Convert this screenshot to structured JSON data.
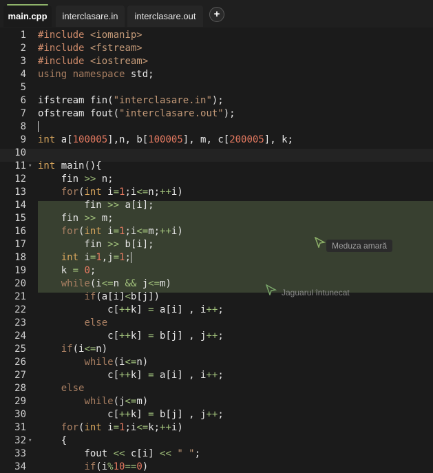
{
  "tabs": [
    {
      "label": "main.cpp",
      "active": true
    },
    {
      "label": "interclasare.in",
      "active": false
    },
    {
      "label": "interclasare.out",
      "active": false
    }
  ],
  "add_tab_label": "+",
  "lines": [
    {
      "num": "1",
      "segs": [
        {
          "c": "pp",
          "t": "#include"
        },
        {
          "c": "",
          "t": " "
        },
        {
          "c": "str",
          "t": "<iomanip>"
        }
      ]
    },
    {
      "num": "2",
      "segs": [
        {
          "c": "pp",
          "t": "#include"
        },
        {
          "c": "",
          "t": " "
        },
        {
          "c": "str",
          "t": "<fstream>"
        }
      ]
    },
    {
      "num": "3",
      "segs": [
        {
          "c": "pp",
          "t": "#include"
        },
        {
          "c": "",
          "t": " "
        },
        {
          "c": "str",
          "t": "<iostream>"
        }
      ]
    },
    {
      "num": "4",
      "segs": [
        {
          "c": "kw",
          "t": "using namespace"
        },
        {
          "c": "",
          "t": " std;"
        }
      ]
    },
    {
      "num": "5",
      "segs": []
    },
    {
      "num": "6",
      "segs": [
        {
          "c": "",
          "t": "ifstream fin("
        },
        {
          "c": "str",
          "t": "\"interclasare.in\""
        },
        {
          "c": "",
          "t": ");"
        }
      ]
    },
    {
      "num": "7",
      "segs": [
        {
          "c": "",
          "t": "ofstream fout("
        },
        {
          "c": "str",
          "t": "\"interclasare.out\""
        },
        {
          "c": "",
          "t": ");"
        }
      ]
    },
    {
      "num": "8",
      "segs": []
    },
    {
      "num": "9",
      "segs": [
        {
          "c": "typ",
          "t": "int"
        },
        {
          "c": "",
          "t": " a["
        },
        {
          "c": "num",
          "t": "100005"
        },
        {
          "c": "",
          "t": "],n, b["
        },
        {
          "c": "num",
          "t": "100005"
        },
        {
          "c": "",
          "t": "], m, c["
        },
        {
          "c": "num",
          "t": "200005"
        },
        {
          "c": "",
          "t": "], k;"
        }
      ]
    },
    {
      "num": "10",
      "segs": []
    },
    {
      "num": "11",
      "fold": true,
      "segs": [
        {
          "c": "typ",
          "t": "int"
        },
        {
          "c": "",
          "t": " main(){"
        }
      ]
    },
    {
      "num": "12",
      "segs": [
        {
          "c": "",
          "t": "    fin "
        },
        {
          "c": "op",
          "t": ">>"
        },
        {
          "c": "",
          "t": " n;"
        }
      ]
    },
    {
      "num": "13",
      "segs": [
        {
          "c": "",
          "t": "    "
        },
        {
          "c": "kw",
          "t": "for"
        },
        {
          "c": "",
          "t": "("
        },
        {
          "c": "typ",
          "t": "int"
        },
        {
          "c": "",
          "t": " i"
        },
        {
          "c": "op",
          "t": "="
        },
        {
          "c": "num",
          "t": "1"
        },
        {
          "c": "",
          "t": ";i"
        },
        {
          "c": "op",
          "t": "<="
        },
        {
          "c": "",
          "t": "n;"
        },
        {
          "c": "op",
          "t": "++"
        },
        {
          "c": "",
          "t": "i)"
        }
      ]
    },
    {
      "num": "14",
      "segs": [
        {
          "c": "",
          "t": "        fin "
        },
        {
          "c": "op",
          "t": ">>"
        },
        {
          "c": "",
          "t": " a[i];"
        }
      ]
    },
    {
      "num": "15",
      "segs": [
        {
          "c": "",
          "t": "    fin "
        },
        {
          "c": "op",
          "t": ">>"
        },
        {
          "c": "",
          "t": " m;"
        }
      ]
    },
    {
      "num": "16",
      "segs": [
        {
          "c": "",
          "t": "    "
        },
        {
          "c": "kw",
          "t": "for"
        },
        {
          "c": "",
          "t": "("
        },
        {
          "c": "typ",
          "t": "int"
        },
        {
          "c": "",
          "t": " i"
        },
        {
          "c": "op",
          "t": "="
        },
        {
          "c": "num",
          "t": "1"
        },
        {
          "c": "",
          "t": ";i"
        },
        {
          "c": "op",
          "t": "<="
        },
        {
          "c": "",
          "t": "m;"
        },
        {
          "c": "op",
          "t": "++"
        },
        {
          "c": "",
          "t": "i)"
        }
      ]
    },
    {
      "num": "17",
      "segs": [
        {
          "c": "",
          "t": "        fin "
        },
        {
          "c": "op",
          "t": ">>"
        },
        {
          "c": "",
          "t": " b[i];"
        }
      ]
    },
    {
      "num": "18",
      "segs": [
        {
          "c": "",
          "t": "    "
        },
        {
          "c": "typ",
          "t": "int"
        },
        {
          "c": "",
          "t": " i"
        },
        {
          "c": "op",
          "t": "="
        },
        {
          "c": "num",
          "t": "1"
        },
        {
          "c": "",
          "t": ",j"
        },
        {
          "c": "op",
          "t": "="
        },
        {
          "c": "num",
          "t": "1"
        },
        {
          "c": "",
          "t": ";"
        }
      ]
    },
    {
      "num": "19",
      "segs": [
        {
          "c": "",
          "t": "    k "
        },
        {
          "c": "op",
          "t": "="
        },
        {
          "c": "",
          "t": " "
        },
        {
          "c": "num",
          "t": "0"
        },
        {
          "c": "",
          "t": ";"
        }
      ]
    },
    {
      "num": "20",
      "segs": [
        {
          "c": "",
          "t": "    "
        },
        {
          "c": "kw",
          "t": "while"
        },
        {
          "c": "",
          "t": "(i"
        },
        {
          "c": "op",
          "t": "<="
        },
        {
          "c": "",
          "t": "n "
        },
        {
          "c": "op",
          "t": "&&"
        },
        {
          "c": "",
          "t": " j"
        },
        {
          "c": "op",
          "t": "<="
        },
        {
          "c": "",
          "t": "m)"
        }
      ]
    },
    {
      "num": "21",
      "segs": [
        {
          "c": "",
          "t": "        "
        },
        {
          "c": "kw",
          "t": "if"
        },
        {
          "c": "",
          "t": "(a[i]"
        },
        {
          "c": "op",
          "t": "<"
        },
        {
          "c": "",
          "t": "b[j])"
        }
      ]
    },
    {
      "num": "22",
      "segs": [
        {
          "c": "",
          "t": "            c["
        },
        {
          "c": "op",
          "t": "++"
        },
        {
          "c": "",
          "t": "k] "
        },
        {
          "c": "op",
          "t": "="
        },
        {
          "c": "",
          "t": " a[i] , i"
        },
        {
          "c": "op",
          "t": "++"
        },
        {
          "c": "",
          "t": ";"
        }
      ]
    },
    {
      "num": "23",
      "segs": [
        {
          "c": "",
          "t": "        "
        },
        {
          "c": "kw",
          "t": "else"
        }
      ]
    },
    {
      "num": "24",
      "segs": [
        {
          "c": "",
          "t": "            c["
        },
        {
          "c": "op",
          "t": "++"
        },
        {
          "c": "",
          "t": "k] "
        },
        {
          "c": "op",
          "t": "="
        },
        {
          "c": "",
          "t": " b[j] , j"
        },
        {
          "c": "op",
          "t": "++"
        },
        {
          "c": "",
          "t": ";"
        }
      ]
    },
    {
      "num": "25",
      "segs": [
        {
          "c": "",
          "t": "    "
        },
        {
          "c": "kw",
          "t": "if"
        },
        {
          "c": "",
          "t": "(i"
        },
        {
          "c": "op",
          "t": "<="
        },
        {
          "c": "",
          "t": "n)"
        }
      ]
    },
    {
      "num": "26",
      "segs": [
        {
          "c": "",
          "t": "        "
        },
        {
          "c": "kw",
          "t": "while"
        },
        {
          "c": "",
          "t": "(i"
        },
        {
          "c": "op",
          "t": "<="
        },
        {
          "c": "",
          "t": "n)"
        }
      ]
    },
    {
      "num": "27",
      "segs": [
        {
          "c": "",
          "t": "            c["
        },
        {
          "c": "op",
          "t": "++"
        },
        {
          "c": "",
          "t": "k] "
        },
        {
          "c": "op",
          "t": "="
        },
        {
          "c": "",
          "t": " a[i] , i"
        },
        {
          "c": "op",
          "t": "++"
        },
        {
          "c": "",
          "t": ";"
        }
      ]
    },
    {
      "num": "28",
      "segs": [
        {
          "c": "",
          "t": "    "
        },
        {
          "c": "kw",
          "t": "else"
        }
      ]
    },
    {
      "num": "29",
      "segs": [
        {
          "c": "",
          "t": "        "
        },
        {
          "c": "kw",
          "t": "while"
        },
        {
          "c": "",
          "t": "(j"
        },
        {
          "c": "op",
          "t": "<="
        },
        {
          "c": "",
          "t": "m)"
        }
      ]
    },
    {
      "num": "30",
      "segs": [
        {
          "c": "",
          "t": "            c["
        },
        {
          "c": "op",
          "t": "++"
        },
        {
          "c": "",
          "t": "k] "
        },
        {
          "c": "op",
          "t": "="
        },
        {
          "c": "",
          "t": " b[j] , j"
        },
        {
          "c": "op",
          "t": "++"
        },
        {
          "c": "",
          "t": ";"
        }
      ]
    },
    {
      "num": "31",
      "segs": [
        {
          "c": "",
          "t": "    "
        },
        {
          "c": "kw",
          "t": "for"
        },
        {
          "c": "",
          "t": "("
        },
        {
          "c": "typ",
          "t": "int"
        },
        {
          "c": "",
          "t": " i"
        },
        {
          "c": "op",
          "t": "="
        },
        {
          "c": "num",
          "t": "1"
        },
        {
          "c": "",
          "t": ";i"
        },
        {
          "c": "op",
          "t": "<="
        },
        {
          "c": "",
          "t": "k;"
        },
        {
          "c": "op",
          "t": "++"
        },
        {
          "c": "",
          "t": "i)"
        }
      ]
    },
    {
      "num": "32",
      "fold": true,
      "segs": [
        {
          "c": "",
          "t": "    {"
        }
      ]
    },
    {
      "num": "33",
      "segs": [
        {
          "c": "",
          "t": "        fout "
        },
        {
          "c": "op",
          "t": "<<"
        },
        {
          "c": "",
          "t": " c[i] "
        },
        {
          "c": "op",
          "t": "<<"
        },
        {
          "c": "",
          "t": " "
        },
        {
          "c": "str",
          "t": "\" \""
        },
        {
          "c": "",
          "t": ";"
        }
      ]
    },
    {
      "num": "34",
      "segs": [
        {
          "c": "",
          "t": "        "
        },
        {
          "c": "kw",
          "t": "if"
        },
        {
          "c": "",
          "t": "(i"
        },
        {
          "c": "op",
          "t": "%"
        },
        {
          "c": "num",
          "t": "10"
        },
        {
          "c": "op",
          "t": "=="
        },
        {
          "c": "num",
          "t": "0"
        },
        {
          "c": "",
          "t": ")"
        }
      ]
    }
  ],
  "collaborators": [
    {
      "name": "Meduza amară",
      "color": "#8fb36a"
    },
    {
      "name": "Jaguarul întunecat",
      "color": "#7aa66a"
    }
  ],
  "colors": {
    "background": "#1b1b1b",
    "selection": "#384030",
    "accent": "#8fb36a",
    "preprocessor": "#cd8a6a",
    "keyword": "#a97f62",
    "type": "#d8a65d",
    "number": "#e67a61",
    "operator": "#a2c27c"
  }
}
